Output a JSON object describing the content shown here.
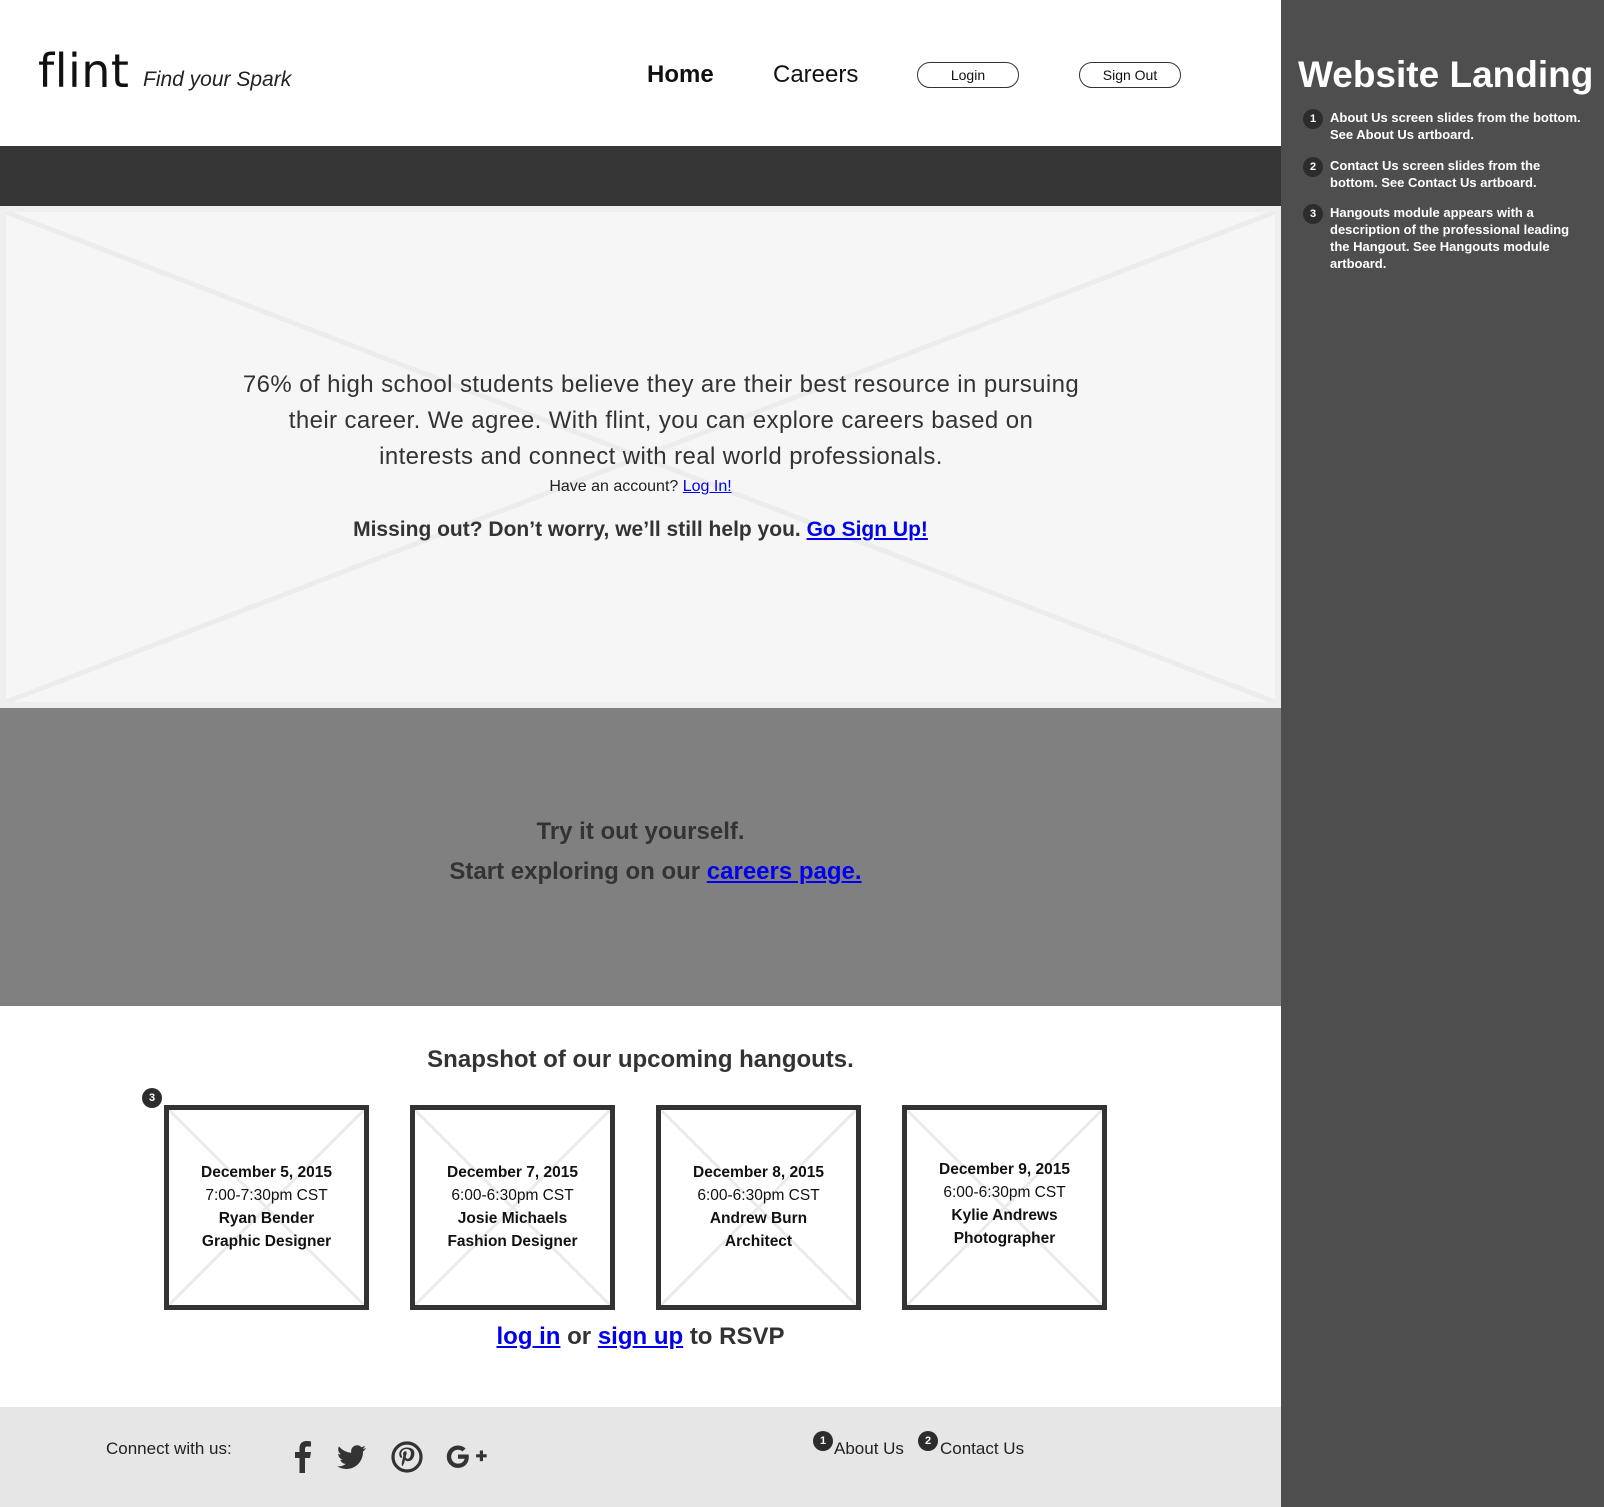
{
  "header": {
    "logo": "flint",
    "tagline": "Find your Spark",
    "nav": {
      "home": "Home",
      "careers": "Careers"
    },
    "login_button": "Login",
    "signout_button": "Sign Out"
  },
  "hero": {
    "line1": "76% of high school students believe they are their best resource in pursuing",
    "line2": "their career. We agree. With flint, you can explore careers based on",
    "line3": "interests and connect with real world professionals.",
    "account_prompt": "Have an account?",
    "login_link": "Log In!",
    "missing_text": "Missing out? Don’t worry, we’ll still help you.",
    "signup_link": "Go Sign Up!"
  },
  "explore": {
    "line1": "Try it out yourself.",
    "line2_prefix": "Start exploring on our",
    "careers_link": "careers page."
  },
  "hangouts": {
    "title": "Snapshot of our upcoming hangouts.",
    "marker": "3",
    "cards": [
      {
        "date": "December 5, 2015",
        "time": "7:00-7:30pm CST",
        "name": "Ryan Bender",
        "role": "Graphic Designer"
      },
      {
        "date": "December 7, 2015",
        "time": "6:00-6:30pm CST",
        "name": "Josie Michaels",
        "role": "Fashion Designer"
      },
      {
        "date": "December 8, 2015",
        "time": "6:00-6:30pm CST",
        "name": "Andrew Burn",
        "role": "Architect"
      },
      {
        "date": "December 9, 2015",
        "time": "6:00-6:30pm CST",
        "name": "Kylie Andrews",
        "role": "Photographer"
      }
    ],
    "rsvp": {
      "login_link": "log in",
      "or": "or",
      "signup_link": "sign up",
      "suffix": "to RSVP"
    }
  },
  "footer": {
    "connect": "Connect with us:",
    "social_icons": [
      "facebook-icon",
      "twitter-icon",
      "pinterest-icon",
      "google-plus-icon"
    ],
    "about": {
      "marker": "1",
      "label": "About Us"
    },
    "contact": {
      "marker": "2",
      "label": "Contact Us"
    }
  },
  "panel": {
    "title": "Website Landing",
    "notes": [
      {
        "num": "1",
        "text": "About Us screen slides from the bottom. See About Us artboard."
      },
      {
        "num": "2",
        "text": "Contact Us screen slides from the bottom. See Contact Us artboard."
      },
      {
        "num": "3",
        "text": "Hangouts module appears with a description of the professional leading the Hangout. See Hangouts module artboard."
      }
    ]
  },
  "colors": {
    "header_band": "#363636",
    "hero_bg": "#f6f6f6",
    "gray_band": "#808080",
    "footer_bg": "#e6e6e6",
    "panel_bg": "#4e4e4e",
    "link": "#0000ee"
  }
}
